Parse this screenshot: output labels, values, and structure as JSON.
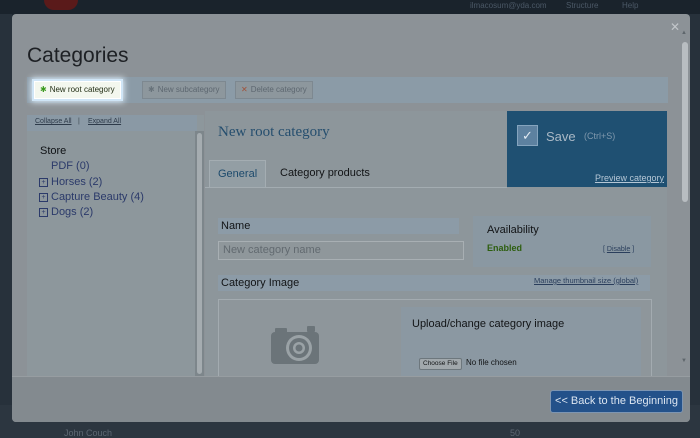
{
  "background": {
    "top_links": [
      "ilmacosum@yda.com",
      "Structure",
      "Help"
    ],
    "row_name": "John Couch",
    "row_number": "50"
  },
  "modal": {
    "title": "Categories",
    "close_icon": "close-icon"
  },
  "toolbar": {
    "new_root": "New root category",
    "new_sub": "New subcategory",
    "delete": "Delete category"
  },
  "tree": {
    "collapse_all": "Collapse All",
    "separator": "|",
    "expand_all": "Expand All",
    "items": [
      {
        "label": "Store"
      },
      {
        "label": "PDF (0)"
      },
      {
        "label": "Horses (2)"
      },
      {
        "label": "Capture Beauty (4)"
      },
      {
        "label": "Dogs (2)"
      }
    ]
  },
  "content": {
    "title": "New root category",
    "save_label": "Save",
    "save_shortcut": "(Ctrl+S)",
    "preview": "Preview category",
    "tabs": [
      {
        "label": "General",
        "active": true
      },
      {
        "label": "Category products",
        "active": false
      }
    ],
    "name_label": "Name",
    "name_placeholder": "New category name",
    "availability_label": "Availability",
    "availability_value": "Enabled",
    "disable_link": "Disable",
    "image_label": "Category Image",
    "thumbnail_link": "Manage thumbnail size (global)",
    "upload_title": "Upload/change category image",
    "choose_file": "Choose File",
    "no_file": "No file chosen"
  },
  "footer": {
    "back_button": "<< Back to the Beginning"
  },
  "colors": {
    "accent": "#1f5072",
    "enabled": "#2d5e0f",
    "back_button": "#23518a"
  }
}
